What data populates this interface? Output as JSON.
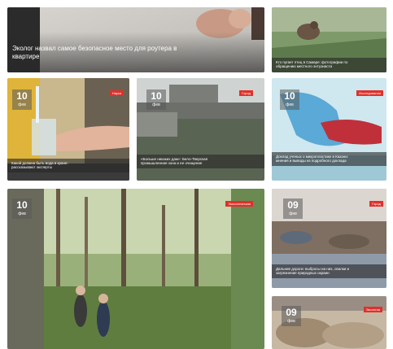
{
  "cards": [
    {
      "headline_1": "Эколог назвал самое безопасное место для роутера в",
      "headline_2": "квартире"
    },
    {
      "headline_1": "Кто пугает птиц в Самаре: фотографии по",
      "headline_2": "обращению местного энтузиаста"
    },
    {
      "day": "10",
      "month": "фев",
      "tag": "Наука",
      "headline_1": "Какой должна быть вода в кране:",
      "headline_2": "рассказывают эксперты"
    },
    {
      "day": "10",
      "month": "фев",
      "tag": "Город",
      "headline_1": "«Больше никаких дам»: Бело-Тверская",
      "headline_2": "промышленная зона и ее очищение"
    },
    {
      "day": "10",
      "month": "фев",
      "tag": "Исследования",
      "headline_1": "Доклад ученых о микропластике в Казани:",
      "headline_2": "мнения и выводы из подробного доклада"
    },
    {
      "day": "10",
      "month": "фев",
      "tag": "Экологическая"
    },
    {
      "day": "09",
      "month": "фев",
      "tag": "Город",
      "headline_1": "Дальние дороги: выбросы на них, свалки и",
      "headline_2": "загрязнение природных окраин"
    },
    {
      "day": "09",
      "month": "фев",
      "tag": "Экология"
    }
  ]
}
